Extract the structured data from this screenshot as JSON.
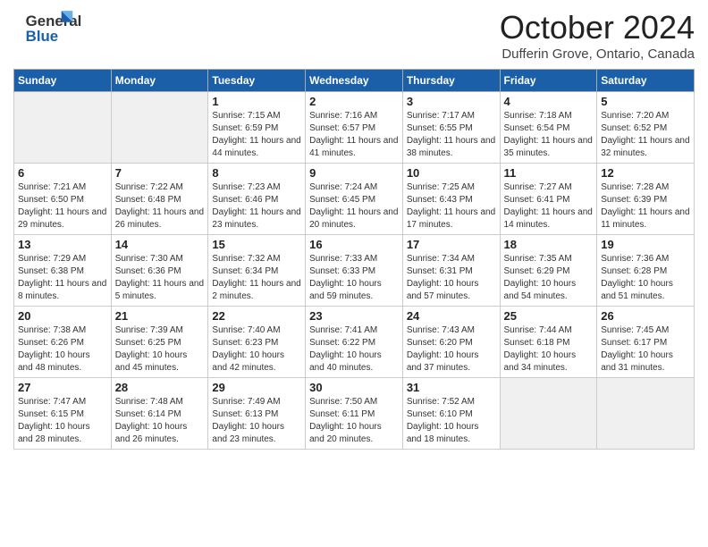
{
  "header": {
    "logo_general": "General",
    "logo_blue": "Blue",
    "month": "October 2024",
    "location": "Dufferin Grove, Ontario, Canada"
  },
  "weekdays": [
    "Sunday",
    "Monday",
    "Tuesday",
    "Wednesday",
    "Thursday",
    "Friday",
    "Saturday"
  ],
  "weeks": [
    [
      {
        "day": "",
        "empty": true
      },
      {
        "day": "",
        "empty": true
      },
      {
        "day": "1",
        "sunrise": "7:15 AM",
        "sunset": "6:59 PM",
        "daylight": "11 hours and 44 minutes."
      },
      {
        "day": "2",
        "sunrise": "7:16 AM",
        "sunset": "6:57 PM",
        "daylight": "11 hours and 41 minutes."
      },
      {
        "day": "3",
        "sunrise": "7:17 AM",
        "sunset": "6:55 PM",
        "daylight": "11 hours and 38 minutes."
      },
      {
        "day": "4",
        "sunrise": "7:18 AM",
        "sunset": "6:54 PM",
        "daylight": "11 hours and 35 minutes."
      },
      {
        "day": "5",
        "sunrise": "7:20 AM",
        "sunset": "6:52 PM",
        "daylight": "11 hours and 32 minutes."
      }
    ],
    [
      {
        "day": "6",
        "sunrise": "7:21 AM",
        "sunset": "6:50 PM",
        "daylight": "11 hours and 29 minutes."
      },
      {
        "day": "7",
        "sunrise": "7:22 AM",
        "sunset": "6:48 PM",
        "daylight": "11 hours and 26 minutes."
      },
      {
        "day": "8",
        "sunrise": "7:23 AM",
        "sunset": "6:46 PM",
        "daylight": "11 hours and 23 minutes."
      },
      {
        "day": "9",
        "sunrise": "7:24 AM",
        "sunset": "6:45 PM",
        "daylight": "11 hours and 20 minutes."
      },
      {
        "day": "10",
        "sunrise": "7:25 AM",
        "sunset": "6:43 PM",
        "daylight": "11 hours and 17 minutes."
      },
      {
        "day": "11",
        "sunrise": "7:27 AM",
        "sunset": "6:41 PM",
        "daylight": "11 hours and 14 minutes."
      },
      {
        "day": "12",
        "sunrise": "7:28 AM",
        "sunset": "6:39 PM",
        "daylight": "11 hours and 11 minutes."
      }
    ],
    [
      {
        "day": "13",
        "sunrise": "7:29 AM",
        "sunset": "6:38 PM",
        "daylight": "11 hours and 8 minutes."
      },
      {
        "day": "14",
        "sunrise": "7:30 AM",
        "sunset": "6:36 PM",
        "daylight": "11 hours and 5 minutes."
      },
      {
        "day": "15",
        "sunrise": "7:32 AM",
        "sunset": "6:34 PM",
        "daylight": "11 hours and 2 minutes."
      },
      {
        "day": "16",
        "sunrise": "7:33 AM",
        "sunset": "6:33 PM",
        "daylight": "10 hours and 59 minutes."
      },
      {
        "day": "17",
        "sunrise": "7:34 AM",
        "sunset": "6:31 PM",
        "daylight": "10 hours and 57 minutes."
      },
      {
        "day": "18",
        "sunrise": "7:35 AM",
        "sunset": "6:29 PM",
        "daylight": "10 hours and 54 minutes."
      },
      {
        "day": "19",
        "sunrise": "7:36 AM",
        "sunset": "6:28 PM",
        "daylight": "10 hours and 51 minutes."
      }
    ],
    [
      {
        "day": "20",
        "sunrise": "7:38 AM",
        "sunset": "6:26 PM",
        "daylight": "10 hours and 48 minutes."
      },
      {
        "day": "21",
        "sunrise": "7:39 AM",
        "sunset": "6:25 PM",
        "daylight": "10 hours and 45 minutes."
      },
      {
        "day": "22",
        "sunrise": "7:40 AM",
        "sunset": "6:23 PM",
        "daylight": "10 hours and 42 minutes."
      },
      {
        "day": "23",
        "sunrise": "7:41 AM",
        "sunset": "6:22 PM",
        "daylight": "10 hours and 40 minutes."
      },
      {
        "day": "24",
        "sunrise": "7:43 AM",
        "sunset": "6:20 PM",
        "daylight": "10 hours and 37 minutes."
      },
      {
        "day": "25",
        "sunrise": "7:44 AM",
        "sunset": "6:18 PM",
        "daylight": "10 hours and 34 minutes."
      },
      {
        "day": "26",
        "sunrise": "7:45 AM",
        "sunset": "6:17 PM",
        "daylight": "10 hours and 31 minutes."
      }
    ],
    [
      {
        "day": "27",
        "sunrise": "7:47 AM",
        "sunset": "6:15 PM",
        "daylight": "10 hours and 28 minutes."
      },
      {
        "day": "28",
        "sunrise": "7:48 AM",
        "sunset": "6:14 PM",
        "daylight": "10 hours and 26 minutes."
      },
      {
        "day": "29",
        "sunrise": "7:49 AM",
        "sunset": "6:13 PM",
        "daylight": "10 hours and 23 minutes."
      },
      {
        "day": "30",
        "sunrise": "7:50 AM",
        "sunset": "6:11 PM",
        "daylight": "10 hours and 20 minutes."
      },
      {
        "day": "31",
        "sunrise": "7:52 AM",
        "sunset": "6:10 PM",
        "daylight": "10 hours and 18 minutes."
      },
      {
        "day": "",
        "empty": true
      },
      {
        "day": "",
        "empty": true
      }
    ]
  ]
}
